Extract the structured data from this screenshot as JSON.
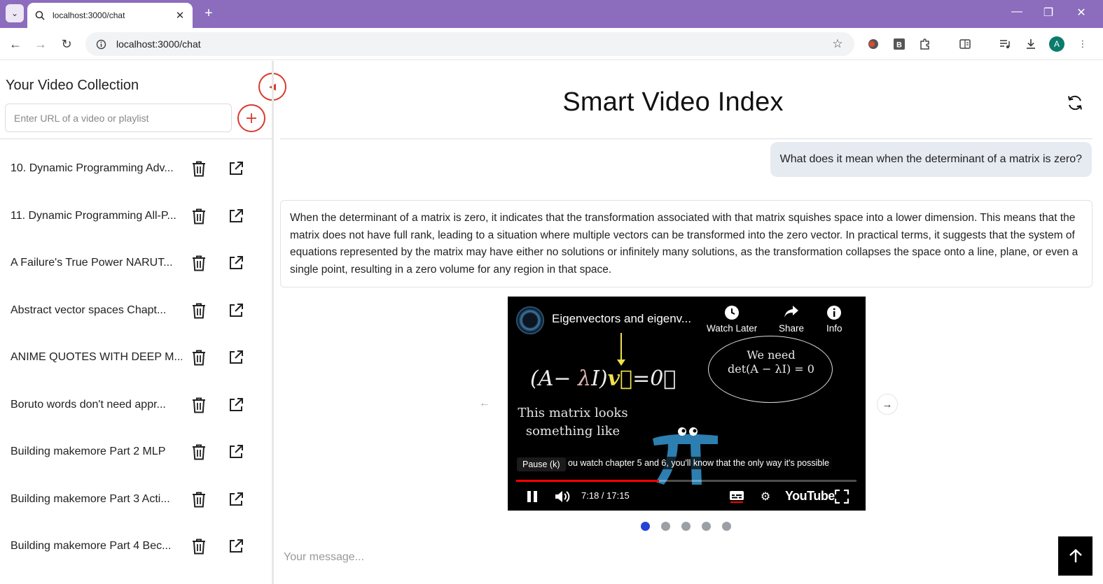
{
  "browser": {
    "tab_title": "localhost:3000/chat",
    "url": "localhost:3000/chat",
    "profile_initial": "A",
    "theme_color": "#8b6cbd"
  },
  "sidebar": {
    "title": "Your Video Collection",
    "url_placeholder": "Enter URL of a video or playlist",
    "accent_color": "#d73a2f",
    "videos": [
      {
        "title": "10. Dynamic Programming Adv..."
      },
      {
        "title": "11. Dynamic Programming All-P..."
      },
      {
        "title": "A Failure's True Power NARUT..."
      },
      {
        "title": "Abstract vector spaces Chapt..."
      },
      {
        "title": "ANIME QUOTES WITH DEEP M..."
      },
      {
        "title": "Boruto words don't need appr..."
      },
      {
        "title": "Building makemore Part 2 MLP"
      },
      {
        "title": "Building makemore Part 3 Acti..."
      },
      {
        "title": "Building makemore Part 4 Bec..."
      }
    ]
  },
  "main": {
    "title": "Smart Video Index",
    "user_message": "What does it mean when the determinant of a matrix is zero?",
    "bot_message": "When the determinant of a matrix is zero, it indicates that the transformation associated with that matrix squishes space into a lower dimension. This means that the matrix does not have full rank, leading to a situation where multiple vectors can be transformed into the zero vector. In practical terms, it suggests that the system of equations represented by the matrix may have either no solutions or infinitely many solutions, as the transformation collapses the space onto a line, plane, or even a single point, resulting in a zero volume for any region in that space.",
    "message_placeholder": "Your message...",
    "carousel": {
      "slide_count": 5,
      "active_index": 0
    },
    "video": {
      "title": "Eigenvectors and eigenv...",
      "watch_later": "Watch Later",
      "share": "Share",
      "info": "Info",
      "bubble_line1": "We need",
      "bubble_line2": "det(A − λI) = 0",
      "note_line1": "This matrix looks",
      "note_line2": "something like",
      "caption": "ou watch chapter 5 and 6, you'll know that the only way it's possible",
      "tooltip": "Pause (k)",
      "time": "7:18 / 17:15",
      "progress": 0.42,
      "brand": "YouTube"
    }
  }
}
